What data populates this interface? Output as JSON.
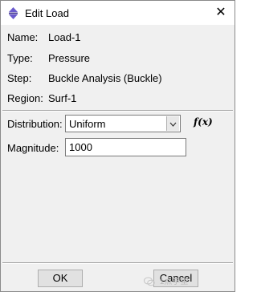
{
  "window": {
    "title": "Edit Load",
    "close_glyph": "✕"
  },
  "info": {
    "name": {
      "label": "Name:",
      "value": "Load-1"
    },
    "type": {
      "label": "Type:",
      "value": "Pressure"
    },
    "step": {
      "label": "Step:",
      "value": "Buckle Analysis (Buckle)"
    },
    "region": {
      "label": "Region:",
      "value": "Surf-1"
    }
  },
  "form": {
    "distribution_label": "Distribution:",
    "distribution_value": "Uniform",
    "fx_label": "f(x)",
    "magnitude_label": "Magnitude:",
    "magnitude_value": "1000"
  },
  "buttons": {
    "ok": "OK",
    "cancel": "Cancel"
  },
  "watermark": {
    "text": "1点学堂"
  },
  "icons": {
    "app": "abaqus-load-icon",
    "close": "close-icon",
    "dropdown": "chevron-down-icon",
    "watermark": "wechat-icon"
  }
}
